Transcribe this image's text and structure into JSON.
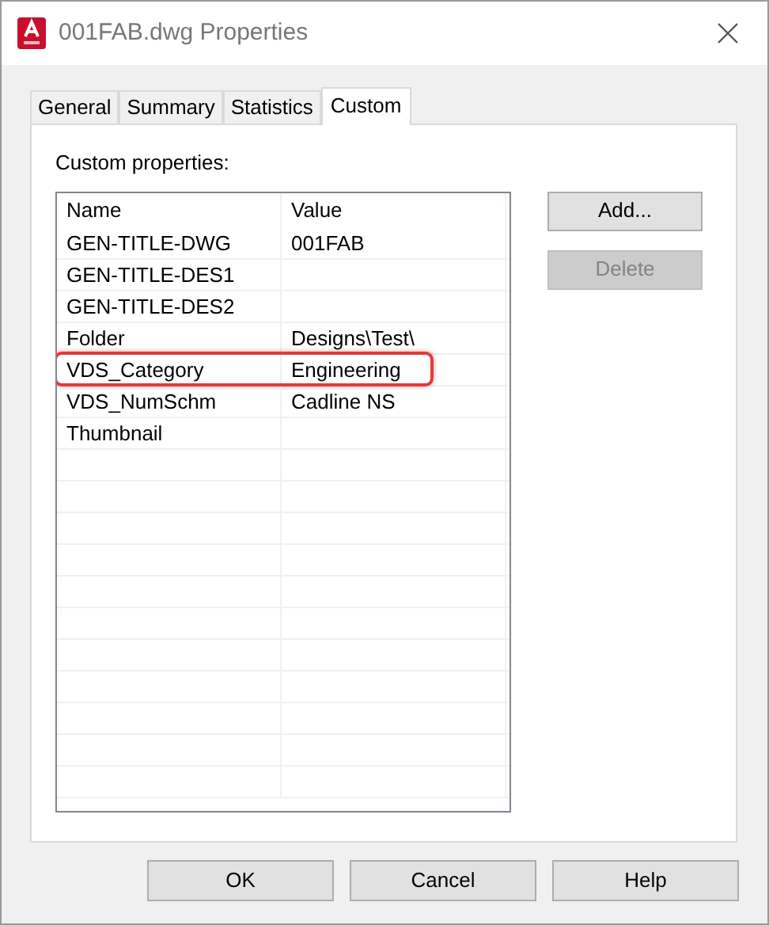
{
  "window": {
    "title": "001FAB.dwg Properties"
  },
  "tabs": [
    {
      "label": "General",
      "selected": false
    },
    {
      "label": "Summary",
      "selected": false
    },
    {
      "label": "Statistics",
      "selected": false
    },
    {
      "label": "Custom",
      "selected": true
    }
  ],
  "list_label": "Custom properties:",
  "table": {
    "columns": [
      "Name",
      "Value"
    ],
    "rows": [
      {
        "name": "GEN-TITLE-DWG",
        "value": "001FAB",
        "highlighted": false
      },
      {
        "name": "GEN-TITLE-DES1",
        "highlighted": false
      },
      {
        "name": "GEN-TITLE-DES2",
        "highlighted": false
      },
      {
        "name": "Folder",
        "value": "Designs\\Test\\",
        "highlighted": false
      },
      {
        "name": "VDS_Category",
        "value": "Engineering",
        "highlighted": true
      },
      {
        "name": "VDS_NumSchm",
        "value": "Cadline NS",
        "highlighted": false
      },
      {
        "name": "Thumbnail",
        "highlighted": false
      }
    ]
  },
  "side_buttons": [
    {
      "label": "Add...",
      "disabled": false
    },
    {
      "label": "Delete",
      "disabled": true
    }
  ],
  "buttons": [
    "OK",
    "Cancel",
    "Help"
  ]
}
